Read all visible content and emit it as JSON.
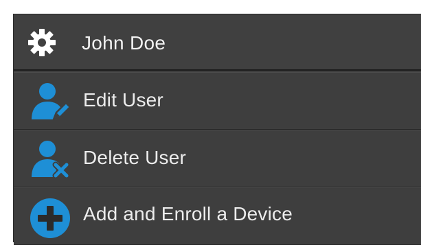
{
  "menu": {
    "header": {
      "icon": "gear-icon",
      "title": "John Doe"
    },
    "items": [
      {
        "icon": "edit-user-icon",
        "label": "Edit User"
      },
      {
        "icon": "delete-user-icon",
        "label": "Delete User"
      },
      {
        "icon": "add-device-icon",
        "label": "Add and Enroll a Device"
      }
    ]
  },
  "colors": {
    "accent": "#1e8fd6",
    "panel": "#3f3f3f",
    "text": "#ececec"
  }
}
